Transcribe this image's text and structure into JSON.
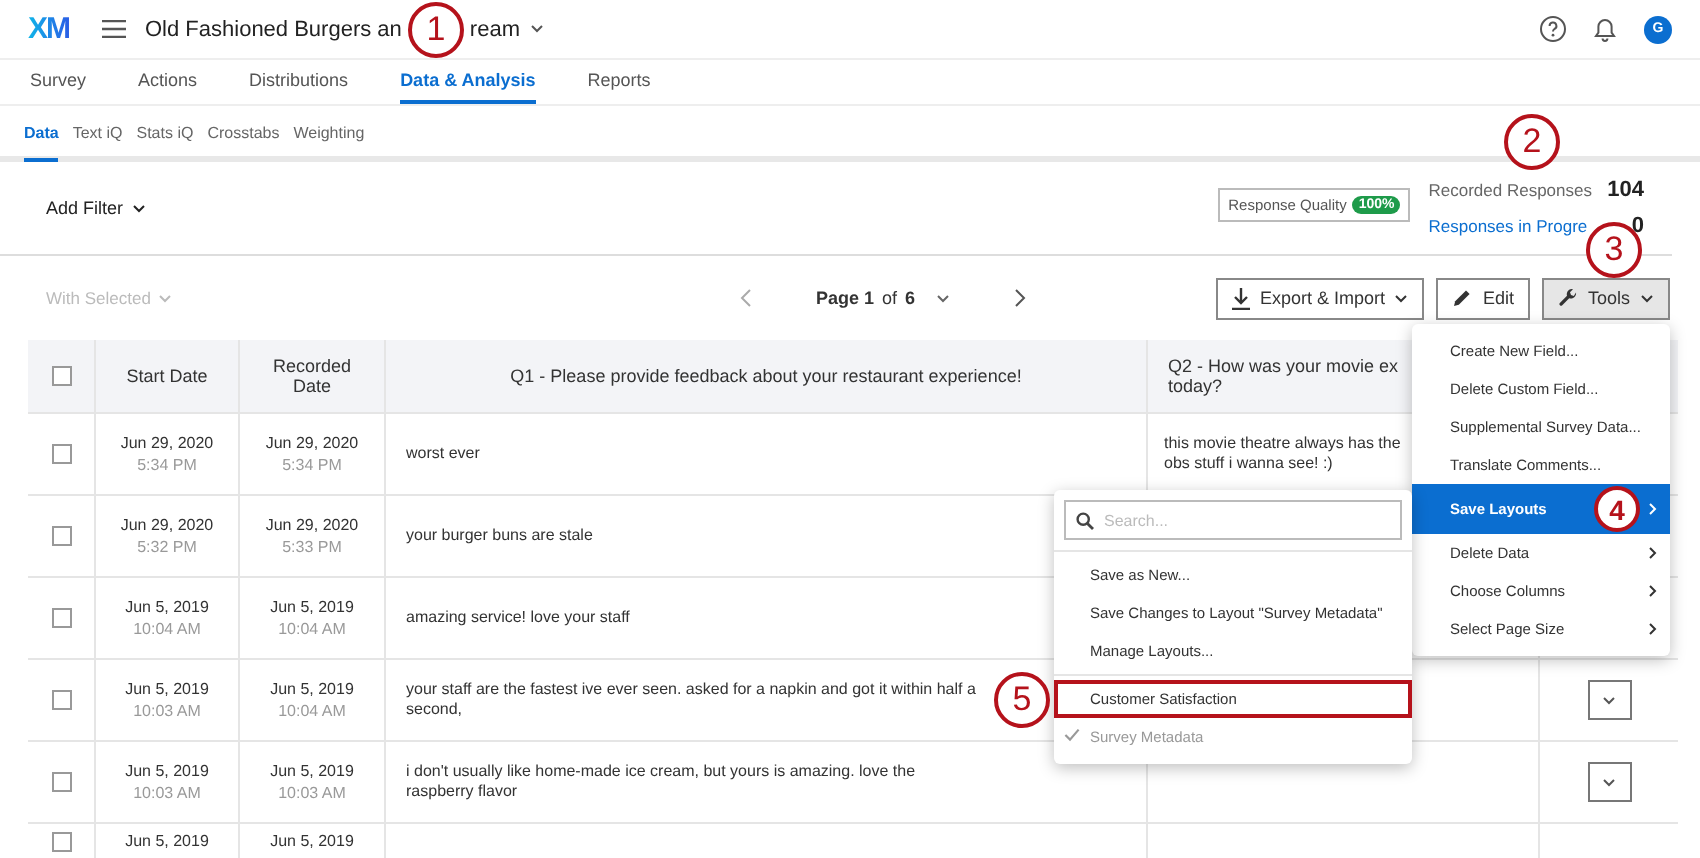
{
  "header": {
    "logo": "XM",
    "title_start": "Old Fashioned Burgers an",
    "title_end": "ream",
    "avatar": "G"
  },
  "tabs": [
    {
      "label": "Survey",
      "selected": false
    },
    {
      "label": "Actions",
      "selected": false
    },
    {
      "label": "Distributions",
      "selected": false
    },
    {
      "label": "Data & Analysis",
      "selected": true
    },
    {
      "label": "Reports",
      "selected": false
    }
  ],
  "subtabs": [
    {
      "label": "Data",
      "selected": true
    },
    {
      "label": "Text iQ",
      "selected": false
    },
    {
      "label": "Stats iQ",
      "selected": false
    },
    {
      "label": "Crosstabs",
      "selected": false
    },
    {
      "label": "Weighting",
      "selected": false
    }
  ],
  "filter": {
    "label": "Add Filter"
  },
  "response_quality": {
    "label": "Response Quality",
    "badge": "100%"
  },
  "stats": [
    {
      "label": "Recorded Responses",
      "value": "104",
      "kind": "plain"
    },
    {
      "label": "Responses in Progre",
      "value": "0",
      "kind": "link"
    }
  ],
  "toolbar": {
    "with_selected": {
      "label": "With Selected",
      "disabled": true
    },
    "pager": "**Page 1** of **6**",
    "buttons": [
      {
        "label": "Export & Import",
        "kind": "export",
        "pressed": false
      },
      {
        "label": "Edit",
        "kind": "edit",
        "pressed": false
      },
      {
        "label": "Tools",
        "kind": "tools",
        "pressed": true
      }
    ]
  },
  "table": {
    "select_all": {
      "checked": false
    },
    "columns": [
      {
        "lines": [
          "Start Date"
        ]
      },
      {
        "lines": [
          "Recorded Date"
        ]
      },
      {
        "lines": [
          "Q1 - Please provide feedback about your restaurant experience!"
        ]
      },
      {
        "lines": [
          "Q2 - How was your movie ex",
          "today?"
        ]
      }
    ],
    "rows": [
      {
        "checked": false,
        "start_date": "Jun 29, 2020",
        "start_time": "5:34 PM",
        "recorded_date": "Jun 29, 2020",
        "recorded_time": "5:34 PM",
        "q1": "worst ever",
        "q2": "this movie theatre always has the obs stuff i wanna see! :)",
        "action_button": false
      },
      {
        "checked": false,
        "start_date": "Jun 29, 2020",
        "start_time": "5:32 PM",
        "recorded_date": "Jun 29, 2020",
        "recorded_time": "5:33 PM",
        "q1": "your burger buns are stale",
        "action_button": false
      },
      {
        "checked": false,
        "start_date": "Jun 5, 2019",
        "start_time": "10:04 AM",
        "recorded_date": "Jun 5, 2019",
        "recorded_time": "10:04 AM",
        "q1": "amazing service! love your staff",
        "action_button": false
      },
      {
        "checked": false,
        "start_date": "Jun 5, 2019",
        "start_time": "10:03 AM",
        "recorded_date": "Jun 5, 2019",
        "recorded_time": "10:04 AM",
        "q1": "your staff are the fastest ive ever seen. asked for a napkin and got it within half a second,",
        "action_button": true
      },
      {
        "checked": false,
        "start_date": "Jun 5, 2019",
        "start_time": "10:03 AM",
        "recorded_date": "Jun 5, 2019",
        "recorded_time": "10:03 AM",
        "q1": "i don't usually like home-made ice cream, but yours is amazing. love the raspberry flavor",
        "action_button": true
      },
      {
        "checked": false,
        "start_date": "Jun 5, 2019",
        "recorded_date": "Jun 5, 2019",
        "action_button": false
      }
    ]
  },
  "tools_menu": {
    "items": [
      {
        "label": "Create New Field...",
        "submenu": false,
        "selected": false
      },
      {
        "label": "Delete Custom Field...",
        "submenu": false,
        "selected": false
      },
      {
        "label": "Supplemental Survey Data...",
        "submenu": false,
        "selected": false
      },
      {
        "label": "Translate Comments...",
        "submenu": false,
        "selected": false
      },
      {
        "label": "Save Layouts",
        "submenu": true,
        "selected": true,
        "callout": "4"
      },
      {
        "label": "Delete Data",
        "submenu": true,
        "selected": false
      },
      {
        "label": "Choose Columns",
        "submenu": true,
        "selected": false
      },
      {
        "label": "Select Page Size",
        "submenu": true,
        "selected": false
      }
    ]
  },
  "layouts_menu": {
    "search": {
      "placeholder": "Search..."
    },
    "items": [
      {
        "label": "Save as New...",
        "kind": "action"
      },
      {
        "label": "Save Changes to Layout \"Survey Metadata\"",
        "kind": "action"
      },
      {
        "label": "Manage Layouts...",
        "kind": "action"
      },
      {
        "label": "Customer Satisfaction",
        "kind": "layout",
        "checked": false,
        "highlighted": true
      },
      {
        "label": "Survey Metadata",
        "kind": "layout",
        "checked": true,
        "highlighted": false
      }
    ]
  },
  "callouts": [
    {
      "number": "1"
    },
    {
      "number": "2"
    },
    {
      "number": "3"
    },
    {
      "number": "5"
    }
  ]
}
